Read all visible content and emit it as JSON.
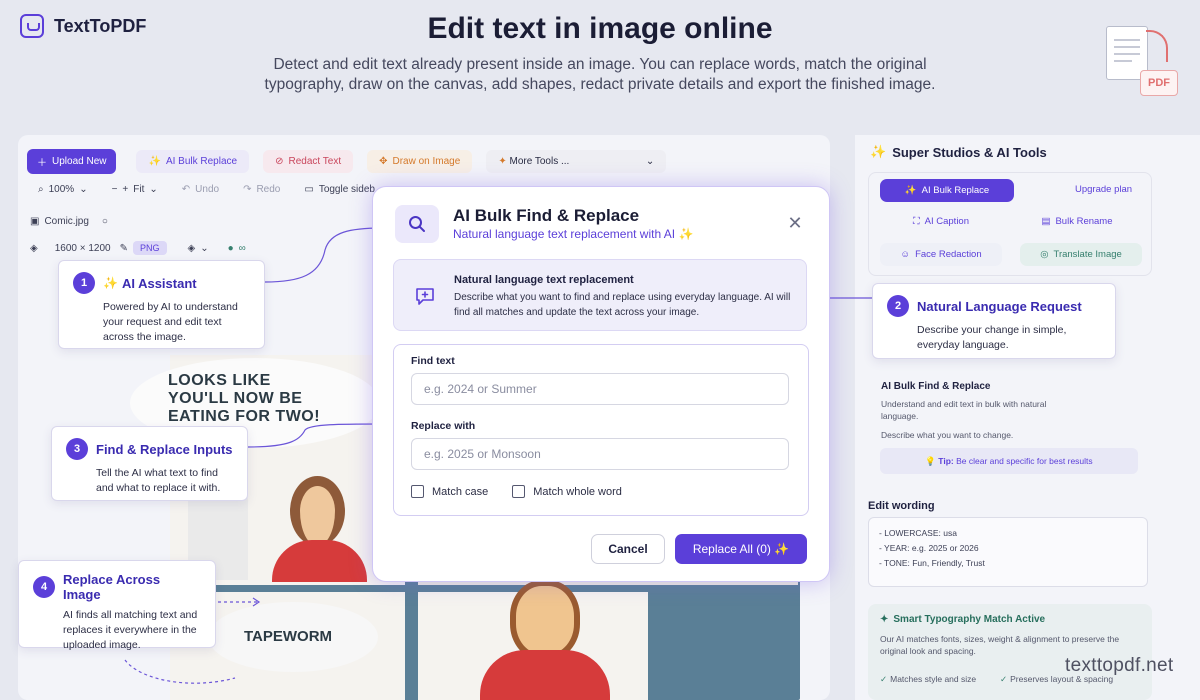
{
  "brand": {
    "name": "TextToPDF"
  },
  "hero": {
    "title": "Edit text in image online",
    "subtitle": "Detect and edit text already present inside an image. You can replace words, match the original typography, draw on the canvas, add shapes, redact private details and export the finished image."
  },
  "pdf_graphic": {
    "badge": "PDF"
  },
  "toolbar": {
    "upload": "Upload New",
    "ai_bulk": "AI Bulk Replace",
    "redact": "Redact Text",
    "draw": "Draw on Image",
    "more": "More Tools",
    "more_suffix": "..."
  },
  "subtoolbar": {
    "zoom": "100%",
    "fit": "Fit",
    "undo": "Undo",
    "redo": "Redo",
    "toggle": "Toggle sideb"
  },
  "file": {
    "name": "Comic.jpg",
    "dimensions": "1600 × 1200",
    "format": "PNG"
  },
  "comic": {
    "speech": "LOOKS LIKE\nYOU'LL NOW BE\nEATING FOR TWO!",
    "tapeworm": "TAPEWORM"
  },
  "callouts": [
    {
      "num": "1",
      "title": "AI Assistant",
      "body": "Powered by AI to understand your request and edit text across the image."
    },
    {
      "num": "2",
      "title": "Natural Language Request",
      "body": "Describe your change in simple, everyday language."
    },
    {
      "num": "3",
      "title": "Find & Replace Inputs",
      "body": "Tell the AI what text to find and what to replace it with."
    },
    {
      "num": "4",
      "title": "Replace Across Image",
      "body": "AI finds all matching text and replaces it everywhere in the uploaded image."
    }
  ],
  "modal": {
    "title": "AI Bulk Find & Replace",
    "subtitle": "Natural language text replacement with AI ✨",
    "nl_title": "Natural language text replacement",
    "nl_text": "Describe what you want to find and replace using everyday language. AI will find all matches and update the text across your image.",
    "find_label": "Find text",
    "find_placeholder": "e.g. 2024 or Summer",
    "replace_label": "Replace with",
    "replace_placeholder": "e.g. 2025 or Monsoon",
    "match_case": "Match case",
    "match_word": "Match whole word",
    "cancel": "Cancel",
    "replace_all": "Replace All (0) ✨"
  },
  "sidebar": {
    "title": "Super Studios & AI Tools",
    "ai_bulk": "AI Bulk Replace",
    "upgrade": "Upgrade plan",
    "ai_caption": "AI Caption",
    "bulk_rename": "Bulk Rename",
    "face_redaction": "Face Redaction",
    "translate": "Translate Image",
    "section_title": "AI Bulk Find & Replace",
    "section_text": "Understand and edit text in bulk with natural language.",
    "section_hint": "Describe what you want to change.",
    "tip_label": "Tip:",
    "tip_text": "Be clear and specific for best results",
    "wording_title": "Edit wording",
    "wording_lines": [
      "- LOWERCASE: usa",
      "- YEAR: e.g. 2025 or 2026",
      "- TONE: Fun, Friendly, Trust"
    ],
    "smart_title": "Smart Typography Match Active",
    "smart_text": "Our AI matches fonts, sizes, weight & alignment to preserve the original look and spacing.",
    "check1": "Matches style and size",
    "check2": "Preserves layout & spacing"
  },
  "watermark": "texttopdf.net",
  "colors": {
    "accent": "#5b3fd9",
    "redact": "#c9465c",
    "draw": "#d57a2c",
    "success": "#37806f"
  }
}
